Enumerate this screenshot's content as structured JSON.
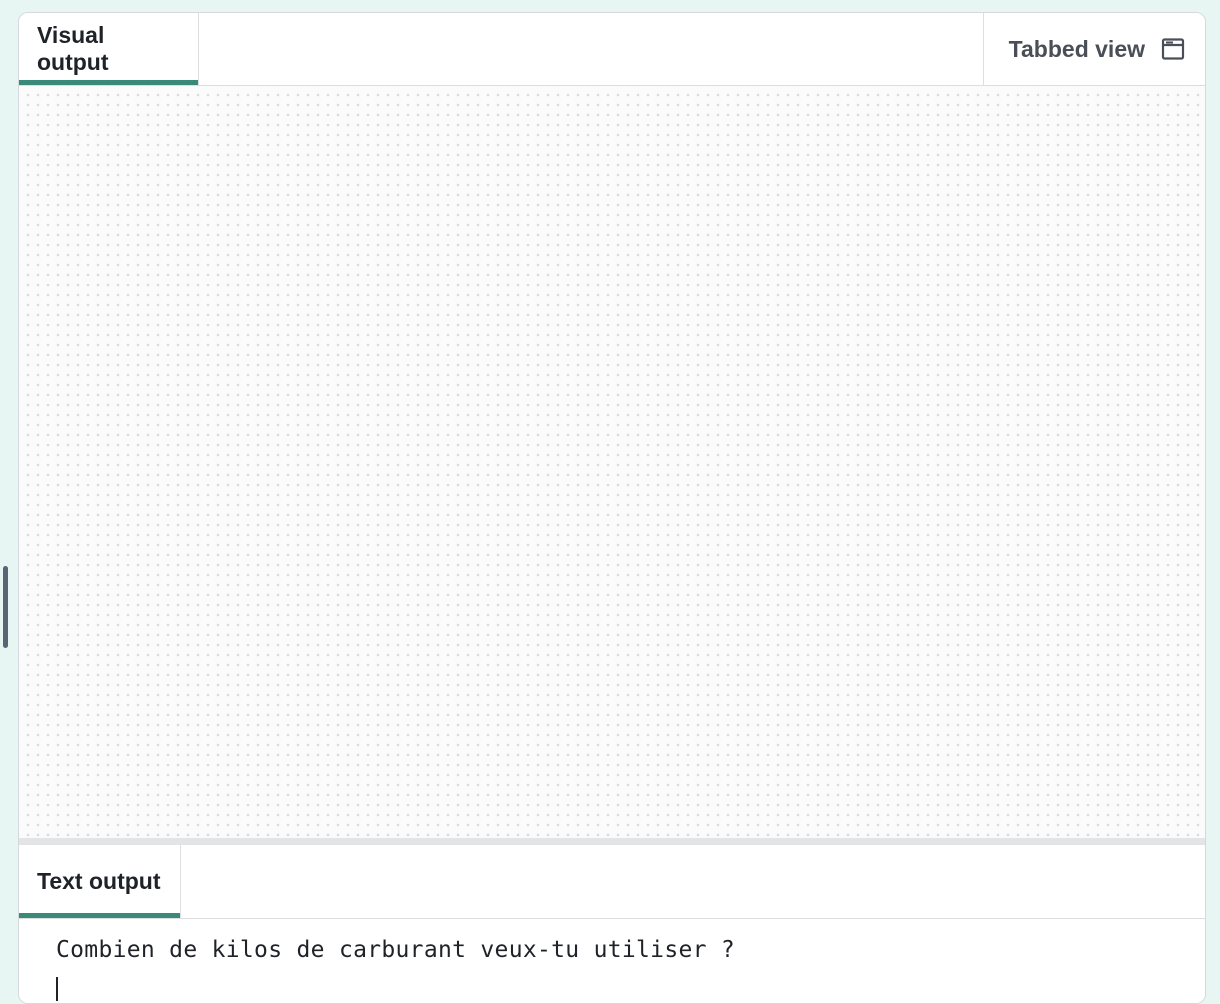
{
  "tabs": {
    "visual_output": "Visual output",
    "text_output": "Text output"
  },
  "toolbar": {
    "tabbed_view_label": "Tabbed view",
    "tabbed_view_icon": "window-icon"
  },
  "console": {
    "lines": [
      "Combien de kilos de carburant veux-tu utiliser ?"
    ],
    "input_value": ""
  },
  "colors": {
    "accent": "#3a8a7a",
    "background": "#e8f6f3"
  }
}
